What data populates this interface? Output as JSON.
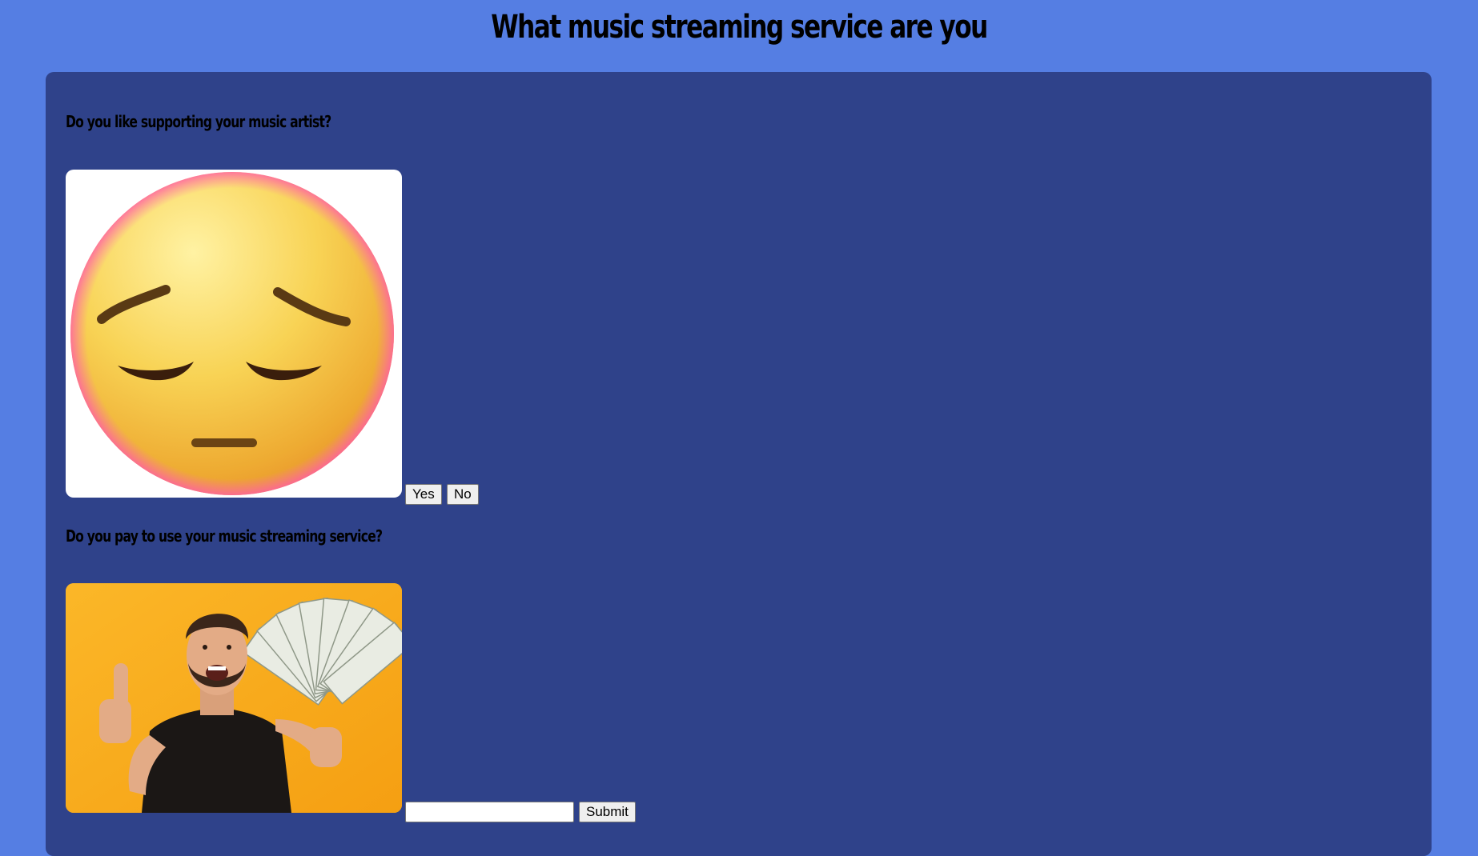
{
  "page": {
    "title": "What music streaming service are you"
  },
  "questions": [
    {
      "text": "Do you like supporting your music artist?",
      "image_icon": "pensive-face-emoji",
      "buttons": [
        "Yes",
        "No"
      ]
    },
    {
      "text": "Do you pay to use your music streaming service?",
      "image_icon": "man-holding-cash-photo",
      "input_value": "",
      "input_placeholder": "",
      "submit_label": "Submit"
    }
  ],
  "colors": {
    "page_background": "#557ee3",
    "panel_background": "#2f428a",
    "photo_background": "#f7ae1e"
  }
}
